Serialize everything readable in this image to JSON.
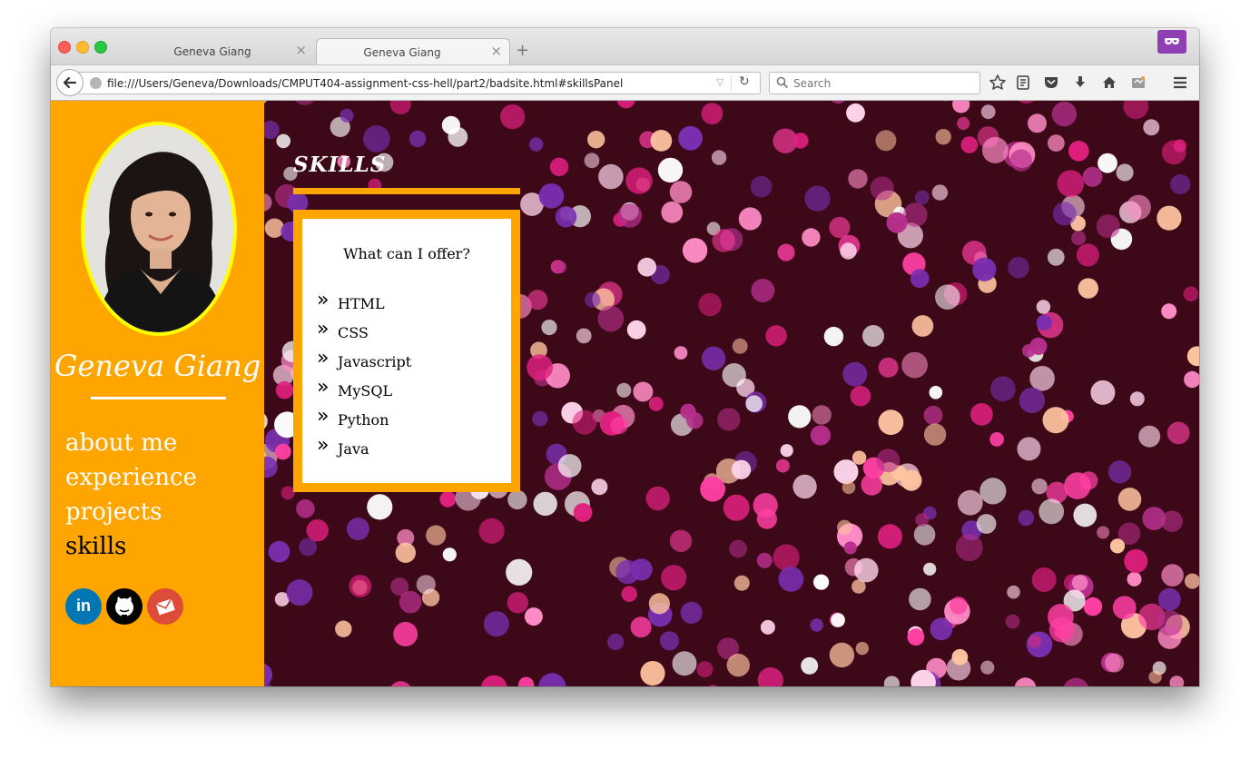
{
  "browser": {
    "tabs": [
      {
        "title": "Geneva Giang",
        "close": "×",
        "active": false
      },
      {
        "title": "Geneva Giang",
        "close": "×",
        "active": true
      }
    ],
    "new_tab": "+",
    "url": "file:///Users/Geneva/Downloads/CMPUT404-assignment-css-hell/part2/badsite.html#skillsPanel",
    "search_placeholder": "Search",
    "icons": [
      "back-icon",
      "globe-icon",
      "dropdown-icon",
      "reload-icon",
      "search-icon",
      "bookmark-star-icon",
      "reading-list-icon",
      "pocket-icon",
      "download-icon",
      "home-icon",
      "screenshot-icon",
      "menu-icon",
      "private-mask-icon"
    ]
  },
  "sidebar": {
    "name": "Geneva Giang",
    "nav": [
      {
        "label": "about me",
        "current": false
      },
      {
        "label": "experience",
        "current": false
      },
      {
        "label": "projects",
        "current": false
      },
      {
        "label": "skills",
        "current": true
      }
    ],
    "social": [
      {
        "icon": "linkedin-icon",
        "text": "in",
        "color": "#0077b5"
      },
      {
        "icon": "github-icon",
        "color": "#000000"
      },
      {
        "icon": "email-icon",
        "color": "#dd4b39"
      }
    ],
    "background": "#ffa500",
    "photo_border": "#ffff00"
  },
  "main": {
    "section_title": "SKILLS",
    "panel_heading": "What can I offer?",
    "skills": [
      "HTML",
      "CSS",
      "Javascript",
      "MySQL",
      "Python",
      "Java"
    ],
    "chevron": "»",
    "accent": "#ffa500"
  }
}
